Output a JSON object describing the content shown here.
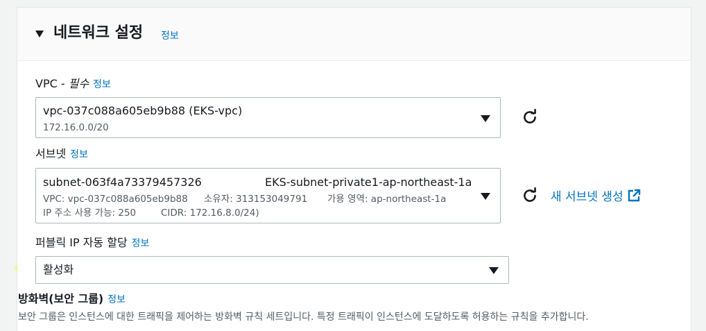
{
  "section": {
    "title": "네트워크 설정",
    "info": "정보"
  },
  "vpc": {
    "label": "VPC - ",
    "required": "필수",
    "info": "정보",
    "selected": "vpc-037c088a605eb9b88 (EKS-vpc)",
    "cidr": "172.16.0.0/20"
  },
  "subnet": {
    "label": "서브넷",
    "info": "정보",
    "id": "subnet-063f4a73379457326",
    "name": "EKS-subnet-private1-ap-northeast-1a",
    "vpc": "VPC: vpc-037c088a605eb9b88",
    "owner": "소유자: 313153049791",
    "az": "가용 영역: ap-northeast-1a",
    "ips": "IP 주소 사용 가능: 250",
    "cidr": "CIDR: 172.16.8.0/24)",
    "create_link": "새 서브넷 생성"
  },
  "public_ip": {
    "label": "퍼블릭 IP 자동 할당",
    "info": "정보",
    "selected": "활성화"
  },
  "firewall": {
    "title": "방화벽(보안 그룹)",
    "info": "정보",
    "description": "보안 그룹은 인스턴스에 대한 트래픽을 제어하는 방화벽 규칙 세트입니다. 특정 트래픽이 인스턴스에 도달하도록 허용하는 규칙을 추가합니다."
  },
  "colors": {
    "link": "#0073bb",
    "highlight": "#fbff1f",
    "border": "#aab7b8"
  },
  "icons": [
    "caret-down-icon",
    "refresh-icon",
    "external-link-icon",
    "dropdown-arrow-icon"
  ]
}
